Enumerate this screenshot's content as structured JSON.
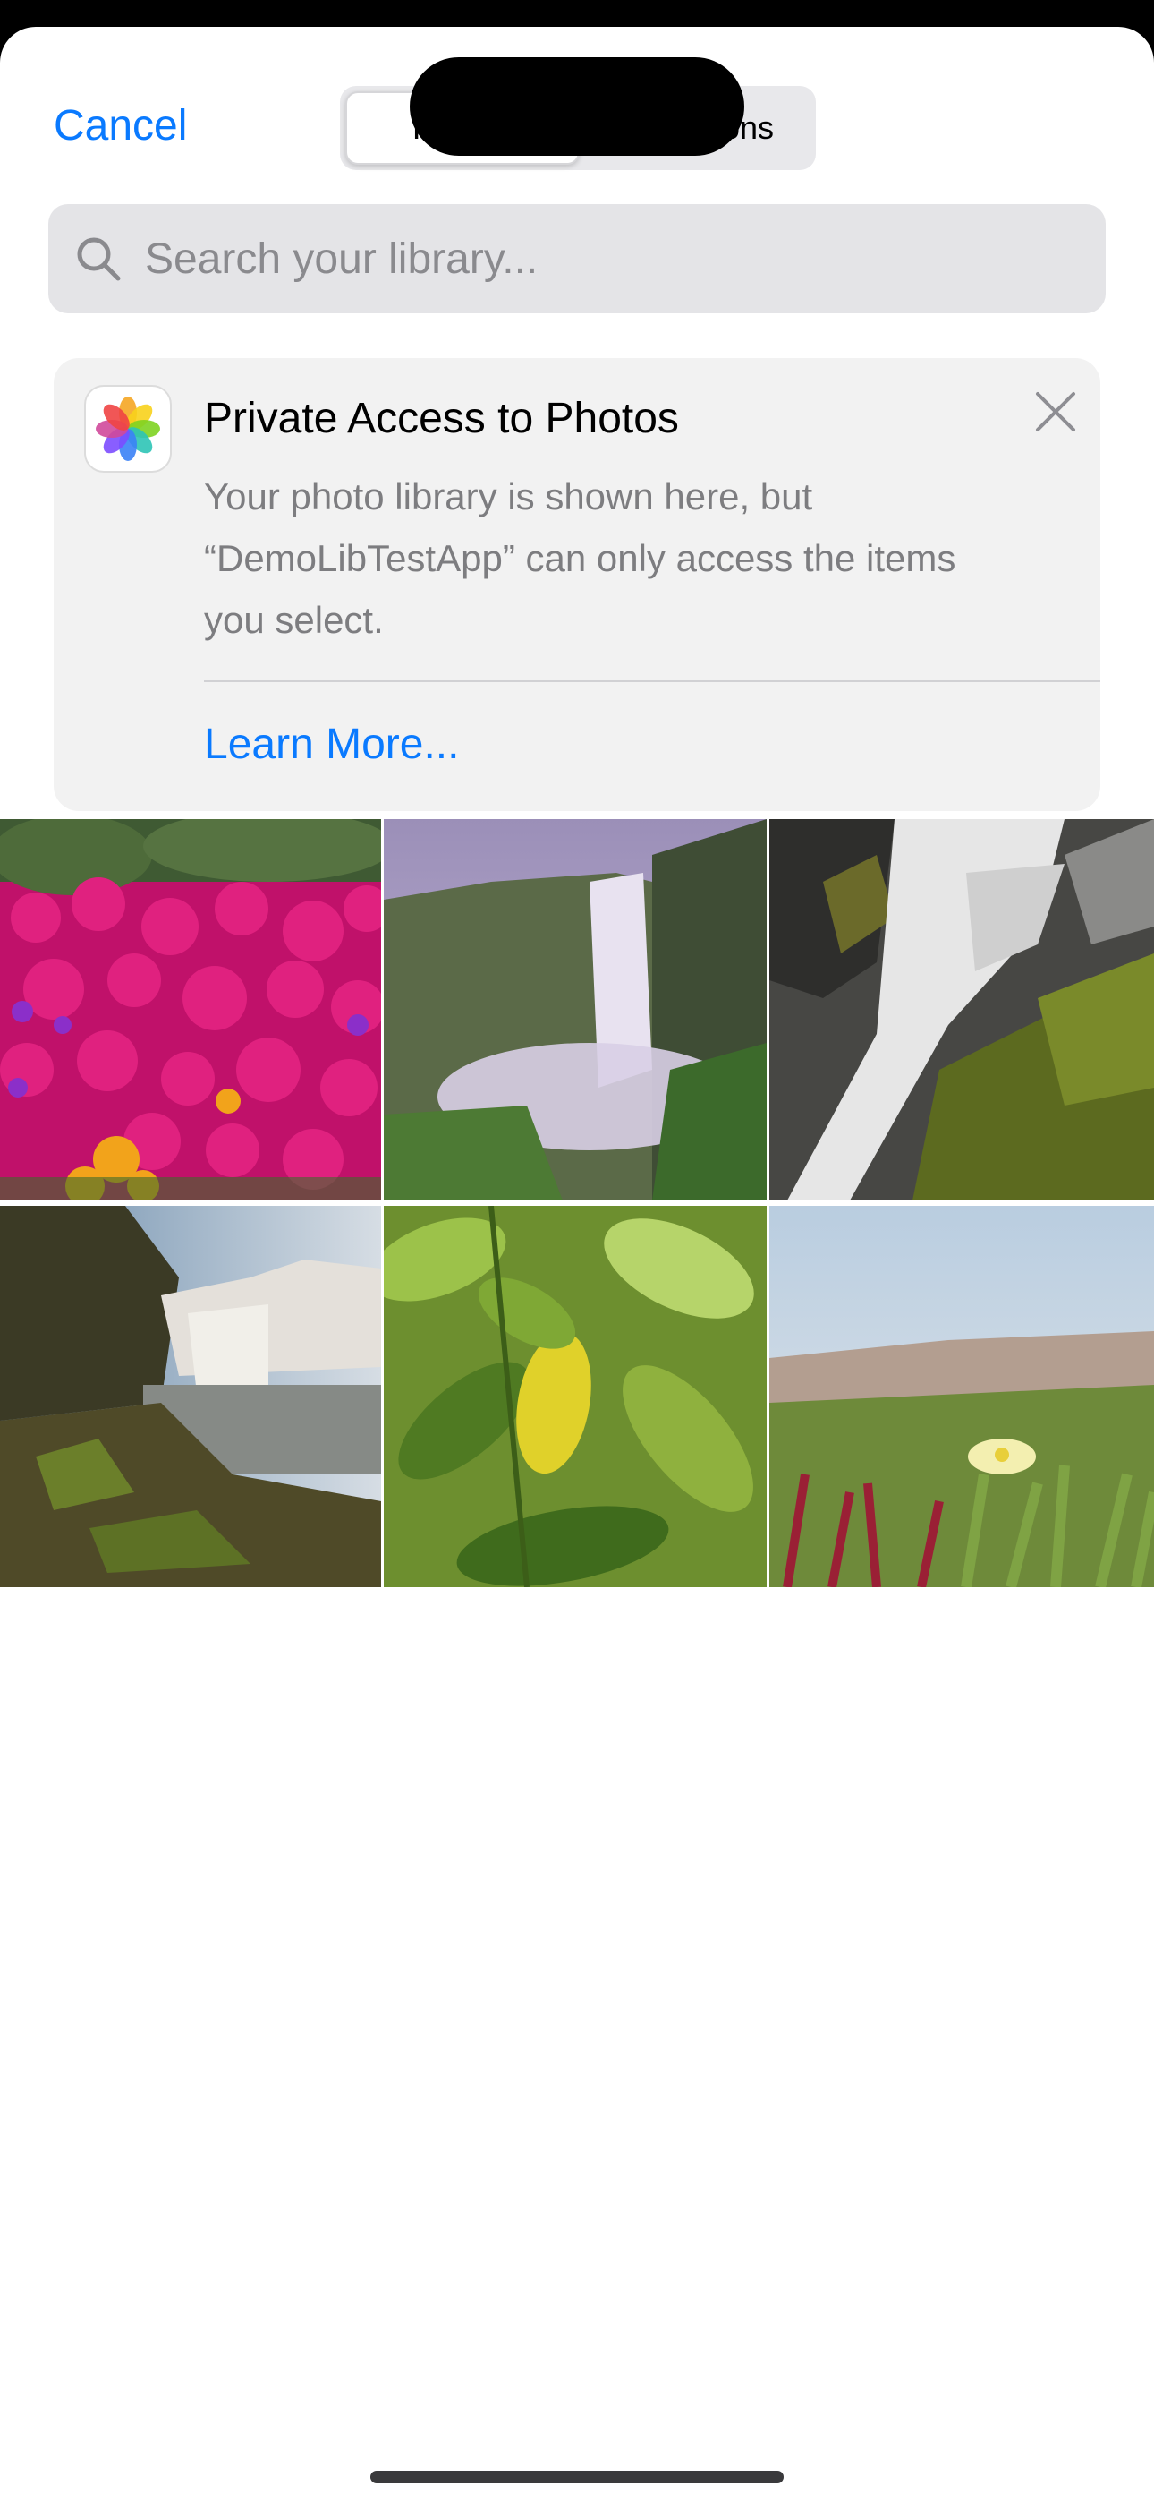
{
  "header": {
    "cancel_label": "Cancel",
    "segments": [
      {
        "label": "Photos",
        "active": true
      },
      {
        "label": "Collections",
        "active": false
      }
    ]
  },
  "search": {
    "placeholder": "Search your library..."
  },
  "banner": {
    "title": "Private Access to Photos",
    "body": "Your photo library is shown here, but “DemoLibTestApp” can only access the items you select.",
    "learn_more_label": "Learn More..."
  },
  "photos": [
    {
      "name": "pink-flowers-photo"
    },
    {
      "name": "misty-waterfall-photo"
    },
    {
      "name": "rushing-water-rocks-photo"
    },
    {
      "name": "waterfall-cliff-photo"
    },
    {
      "name": "green-leaves-photo"
    },
    {
      "name": "ice-plant-flower-photo"
    }
  ],
  "colors": {
    "accent": "#0a7aff",
    "banner_bg": "#f2f2f2",
    "search_bg": "#e4e4e7"
  }
}
